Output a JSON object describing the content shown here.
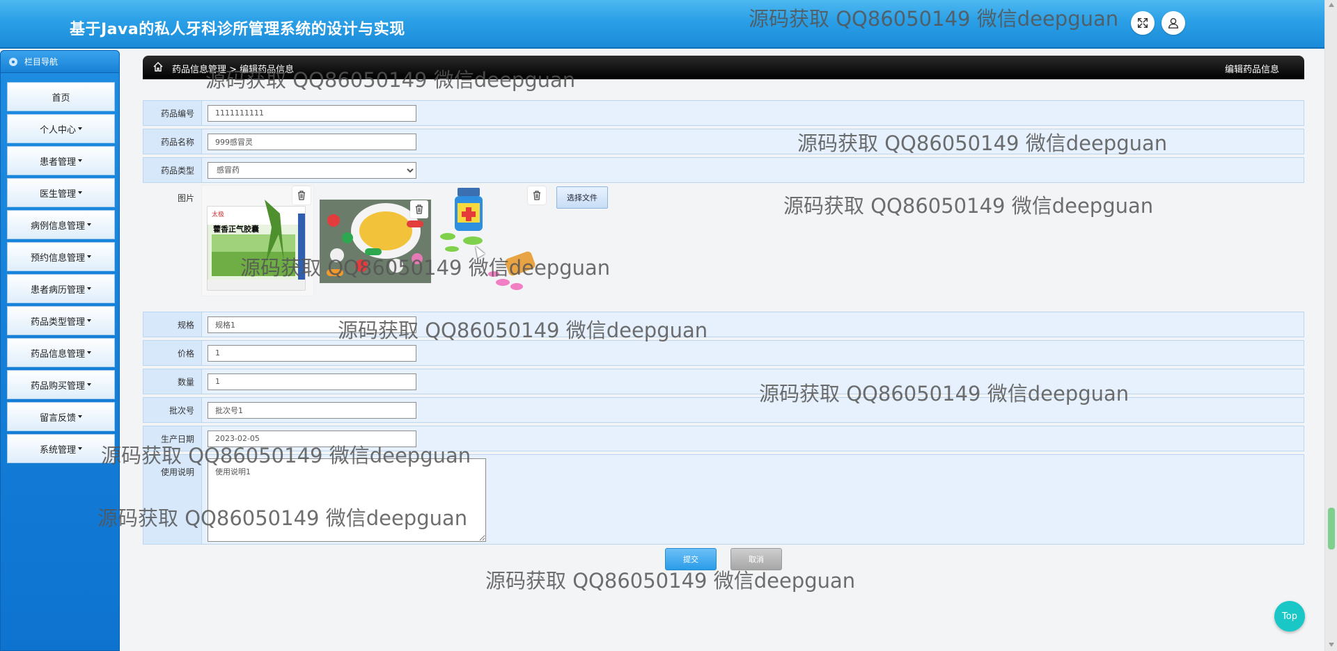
{
  "header": {
    "title": "基于Java的私人牙科诊所管理系统的设计与实现",
    "fullscreen_icon": "expand-icon",
    "user_icon": "user-icon"
  },
  "sidebar": {
    "heading": "栏目导航",
    "items": [
      {
        "label": "首页",
        "dropdown": false
      },
      {
        "label": "个人中心",
        "dropdown": true
      },
      {
        "label": "患者管理",
        "dropdown": true
      },
      {
        "label": "医生管理",
        "dropdown": true
      },
      {
        "label": "病例信息管理",
        "dropdown": true
      },
      {
        "label": "预约信息管理",
        "dropdown": true
      },
      {
        "label": "患者病历管理",
        "dropdown": true
      },
      {
        "label": "药品类型管理",
        "dropdown": true
      },
      {
        "label": "药品信息管理",
        "dropdown": true
      },
      {
        "label": "药品购买管理",
        "dropdown": true
      },
      {
        "label": "留言反馈",
        "dropdown": true
      },
      {
        "label": "系统管理",
        "dropdown": true
      }
    ]
  },
  "breadcrumb": {
    "path": "药品信息管理 > 编辑药品信息",
    "page_title": "编辑药品信息"
  },
  "form": {
    "code_label": "药品编号",
    "code_value": "1111111111",
    "name_label": "药品名称",
    "name_value": "999感冒灵",
    "type_label": "药品类型",
    "type_value": "感冒药",
    "image_label": "图片",
    "choose_file": "选择文件",
    "spec_label": "规格",
    "spec_value": "规格1",
    "price_label": "价格",
    "price_value": "1",
    "qty_label": "数量",
    "qty_value": "1",
    "batch_label": "批次号",
    "batch_value": "批次号1",
    "date_label": "生产日期",
    "date_value": "2023-02-05",
    "usage_label": "使用说明",
    "usage_value": "使用说明1"
  },
  "images": [
    {
      "caption": "藿香正气胶囊",
      "brand": "太极",
      "icon": "medicine-box-photo"
    },
    {
      "caption": "",
      "icon": "pills-bowl-photo"
    },
    {
      "caption": "",
      "icon": "medicine-bottle-photo"
    }
  ],
  "buttons": {
    "submit": "提交",
    "cancel": "取消",
    "top": "Top"
  },
  "watermark": "源码获取 QQ86050149 微信deepguan",
  "colors": {
    "header": "#2a9fe6",
    "sidebar": "#1e8ce0",
    "row_bg": "#e6f1fd",
    "submit": "#2a9ce8",
    "top_button": "#19c7c7"
  }
}
